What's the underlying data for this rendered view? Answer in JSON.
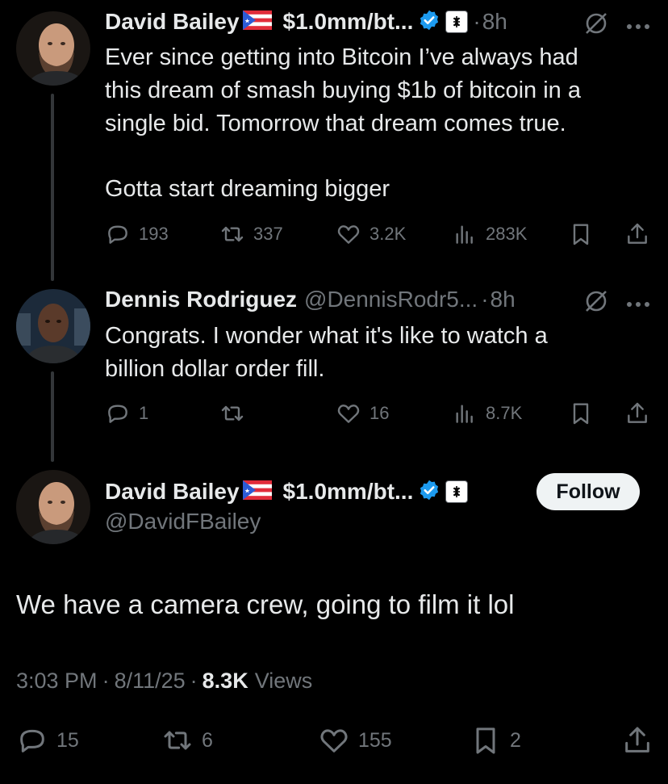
{
  "tweet1": {
    "author_name": "David Bailey",
    "author_title": "$1.0mm/bt...",
    "time": "8h",
    "text_line1": "Ever since getting into Bitcoin I’ve always had",
    "text_line2": "this dream of smash buying $1b of bitcoin in a",
    "text_line3": "single bid. Tomorrow that dream comes true.",
    "text_line4": "Gotta start dreaming bigger",
    "replies": "193",
    "reposts": "337",
    "likes": "3.2K",
    "views": "283K"
  },
  "tweet2": {
    "author_name": "Dennis Rodriguez",
    "author_handle": "@DennisRodr5...",
    "time": "8h",
    "text_line1": "Congrats. I wonder what it's like to watch a",
    "text_line2": "billion dollar order fill.",
    "replies": "1",
    "likes": "16",
    "views": "8.7K"
  },
  "main_tweet": {
    "author_name": "David Bailey",
    "author_title": "$1.0mm/bt...",
    "author_handle": "@DavidFBailey",
    "follow_label": "Follow",
    "text": "We have a camera crew, going to film it lol",
    "time": "3:03 PM",
    "date": "8/11/25",
    "views_count": "8.3K",
    "views_label": "Views",
    "replies": "15",
    "reposts": "6",
    "likes": "155",
    "bookmarks": "2"
  },
  "separators": {
    "dot": "·"
  },
  "icons": {
    "reply": "reply-icon",
    "repost": "repost-icon",
    "like": "heart-icon",
    "views": "views-icon",
    "bookmark": "bookmark-icon",
    "share": "share-icon",
    "grok": "grok-icon",
    "more": "more-icon",
    "verified": "verified-icon",
    "flag": "puerto-rico-flag-icon",
    "affiliate": "affiliate-badge-icon"
  },
  "colors": {
    "background": "#000000",
    "text": "#e7e9ea",
    "muted": "#71767b",
    "verified": "#1d9bf0",
    "line": "#333639"
  }
}
